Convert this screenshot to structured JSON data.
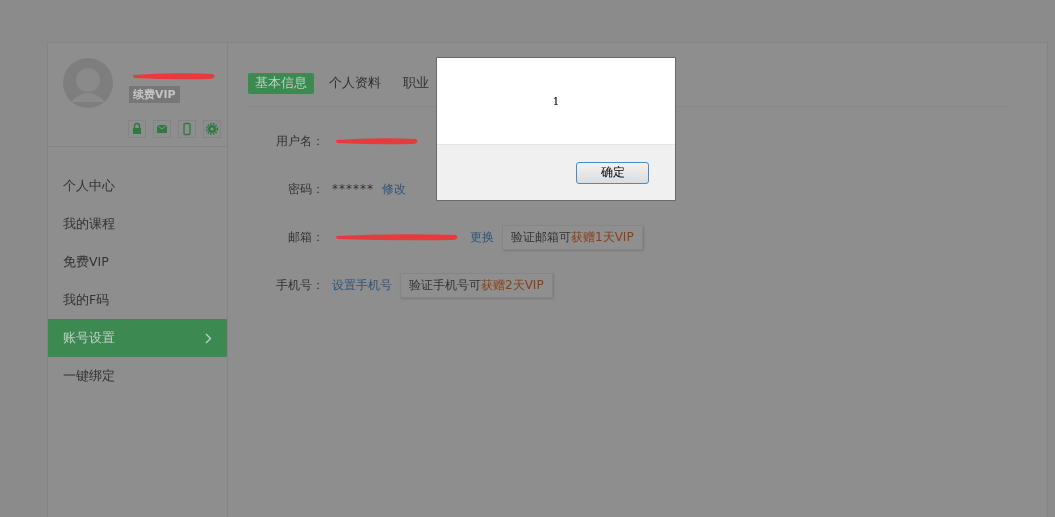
{
  "profile": {
    "name_redacted": true,
    "badge": "续费VIP"
  },
  "sidebar": {
    "items": [
      {
        "label": "个人中心",
        "selected": false
      },
      {
        "label": "我的课程",
        "selected": false
      },
      {
        "label": "免费VIP",
        "selected": false
      },
      {
        "label": "我的F码",
        "selected": false
      },
      {
        "label": "账号设置",
        "selected": true
      },
      {
        "label": "一键绑定",
        "selected": false
      }
    ]
  },
  "tabs": [
    {
      "label": "基本信息",
      "selected": true
    },
    {
      "label": "个人资料",
      "selected": false
    },
    {
      "label": "职业",
      "selected": false
    }
  ],
  "fields": [
    {
      "label": "用户名：",
      "redacted": true
    },
    {
      "label": "密码：",
      "redacted": false,
      "value": "******",
      "link": "修改"
    },
    {
      "label": "邮箱：",
      "redacted": true,
      "link": "更换",
      "promo": {
        "text": "验证邮箱可",
        "highlight": "获赠1天VIP"
      }
    },
    {
      "label": "手机号：",
      "redacted": false,
      "link": "设置手机号",
      "promo": {
        "text": "验证手机号可",
        "highlight": "获赠2天VIP"
      }
    }
  ],
  "dialog": {
    "message": "1",
    "button": "确定"
  }
}
